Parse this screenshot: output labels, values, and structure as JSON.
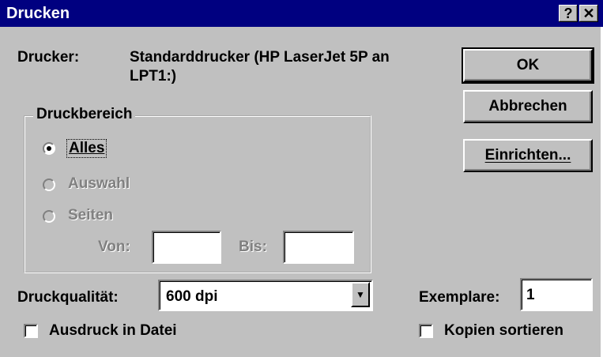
{
  "window": {
    "title": "Drucken",
    "help_button": "?",
    "close_button": "✕"
  },
  "printer": {
    "label": "Drucker:",
    "name_line1": "Standarddrucker (HP LaserJet 5P an",
    "name_line2": "LPT1:)"
  },
  "buttons": {
    "ok": "OK",
    "cancel": "Abbrechen",
    "setup": "Einrichten..."
  },
  "range": {
    "legend": "Druckbereich",
    "all": "Alles",
    "selection": "Auswahl",
    "pages": "Seiten",
    "from_label": "Von:",
    "to_label": "Bis:",
    "from_value": "",
    "to_value": "",
    "selected": "all"
  },
  "quality": {
    "label": "Druckqualität:",
    "value": "600 dpi"
  },
  "copies": {
    "label": "Exemplare:",
    "value": "1"
  },
  "print_to_file": {
    "label": "Ausdruck in Datei",
    "checked": false
  },
  "collate": {
    "label": "Kopien sortieren",
    "checked": false
  }
}
